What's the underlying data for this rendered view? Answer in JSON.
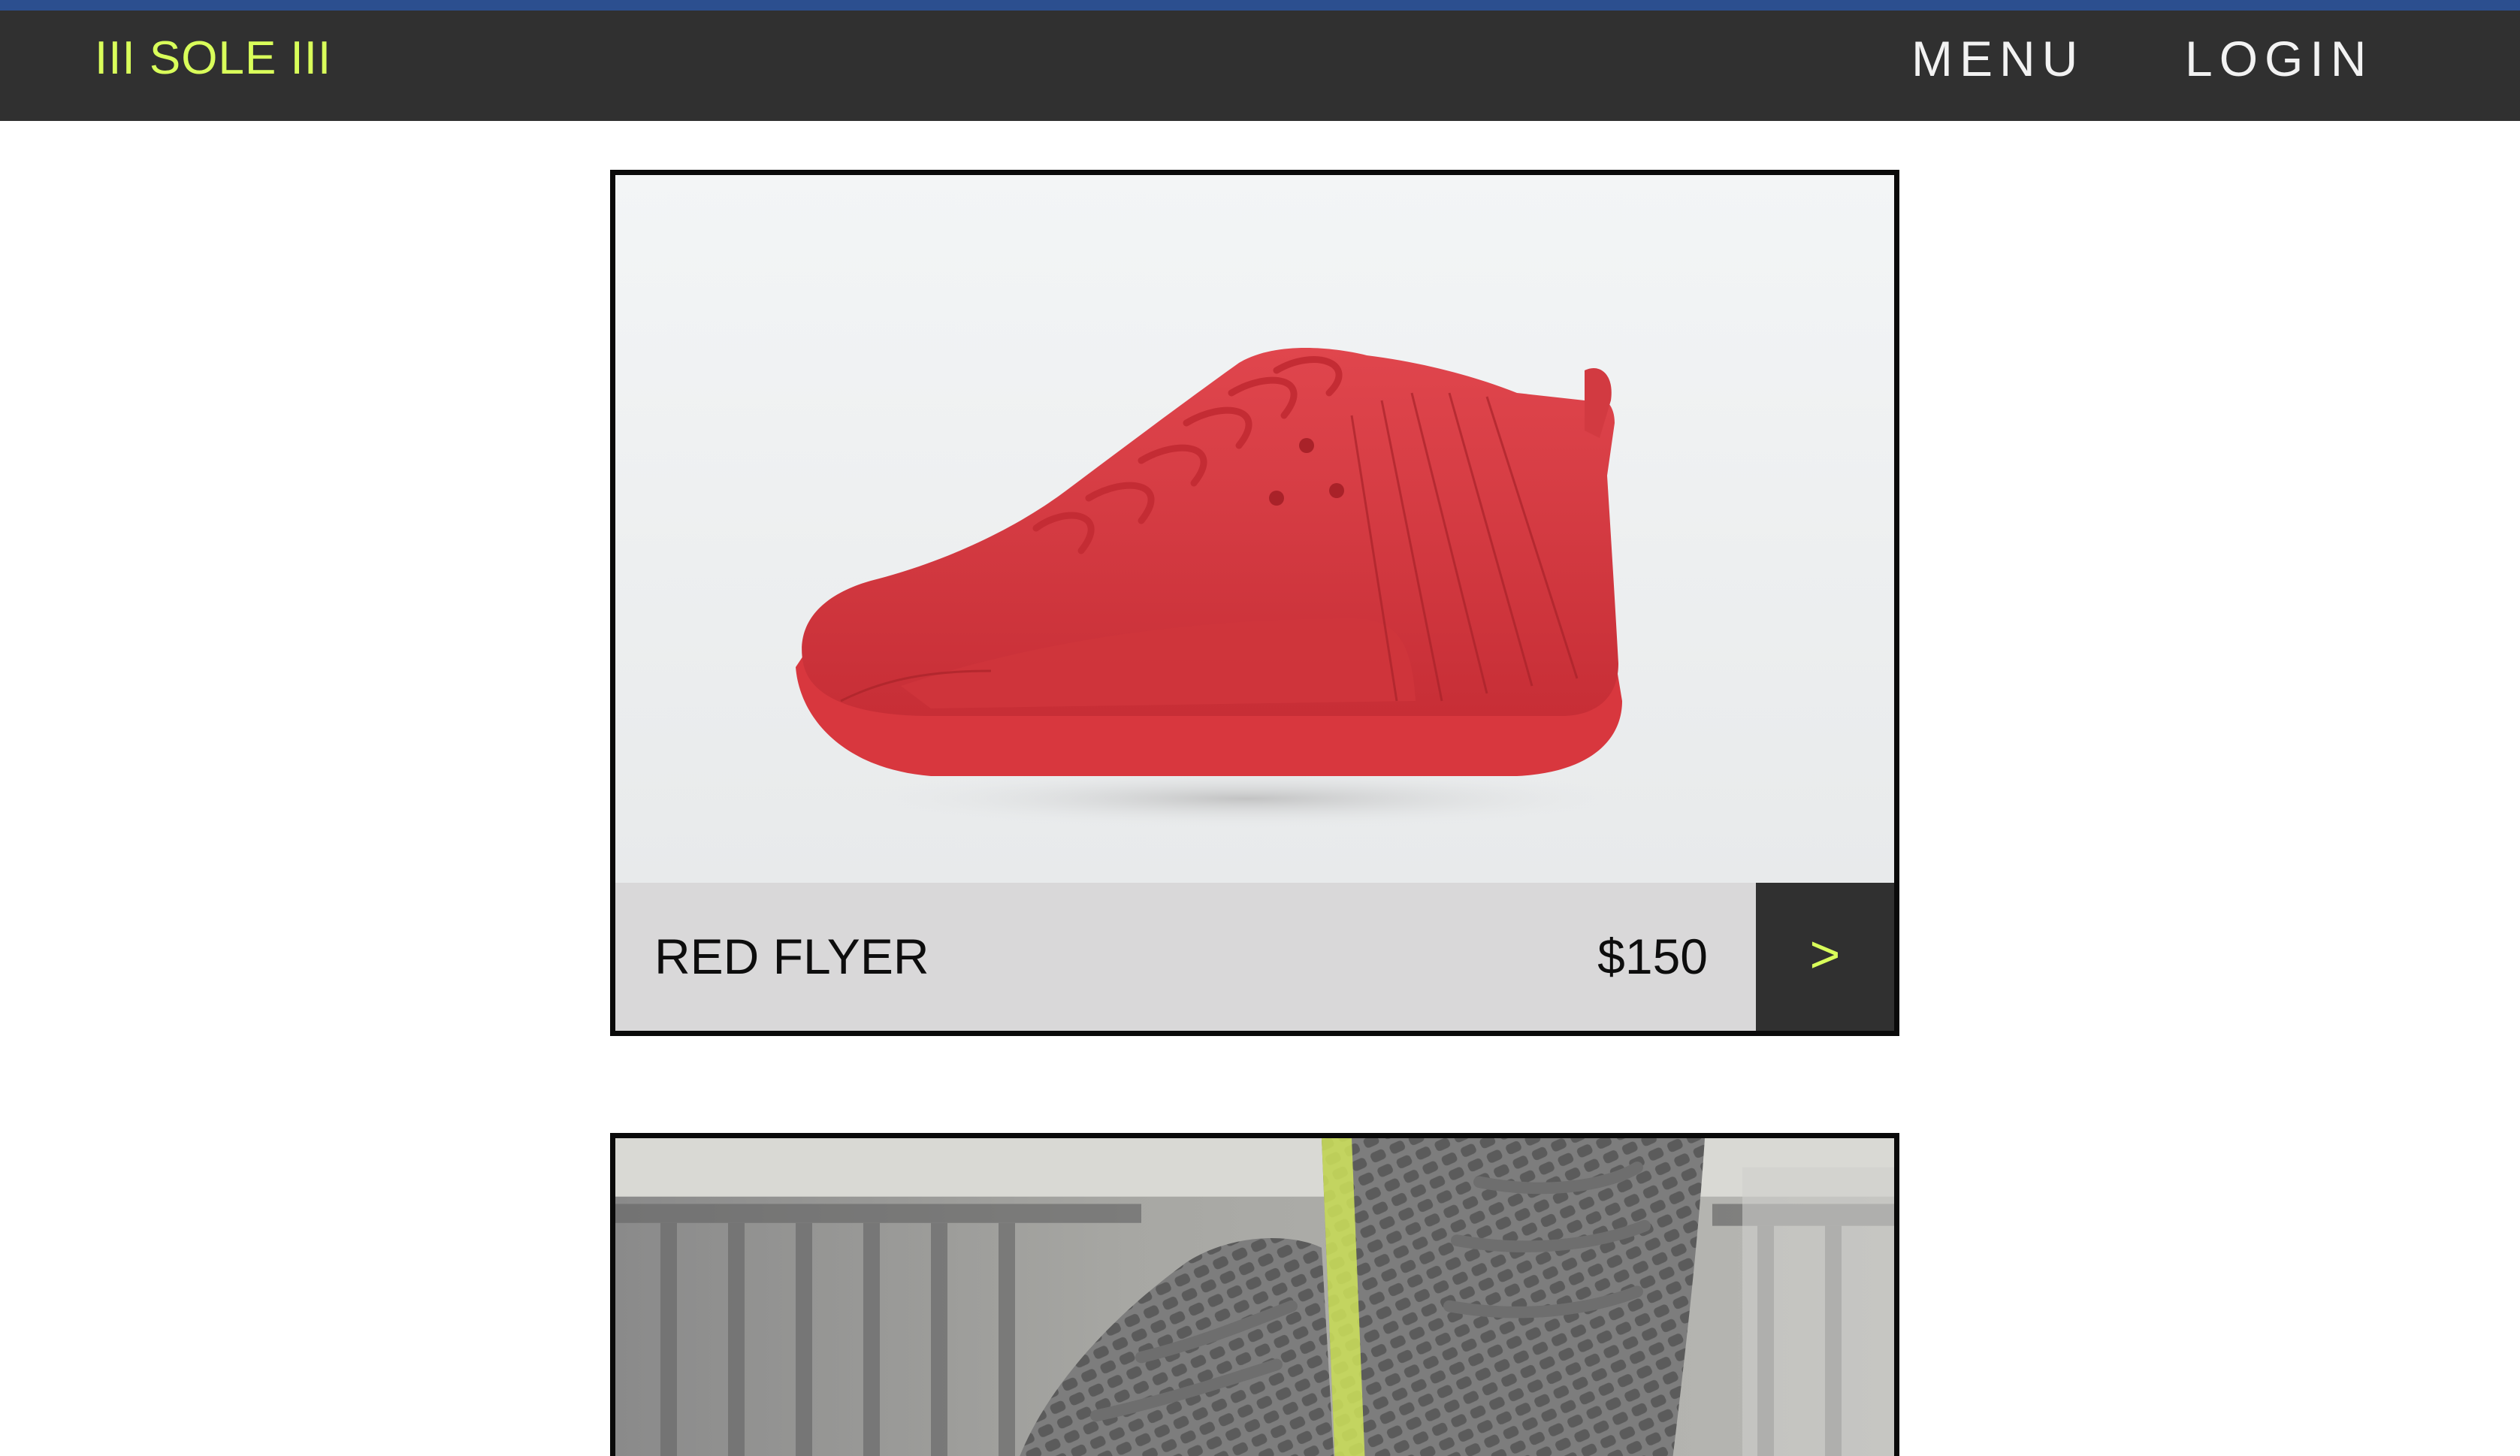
{
  "header": {
    "brand": "III SOLE III",
    "menu_label": "MENU",
    "login_label": "LOGIN"
  },
  "colors": {
    "accent": "#d9ff5a",
    "nav_bg": "#303030",
    "info_bar_bg": "#d9d8d9",
    "top_strip": "#2c4f8f"
  },
  "products": [
    {
      "name": "RED FLYER",
      "price": "$150",
      "action_label": ">",
      "image": "red-high-top-sneaker-photo"
    },
    {
      "image": "grey-knit-sneakers-photo"
    }
  ]
}
